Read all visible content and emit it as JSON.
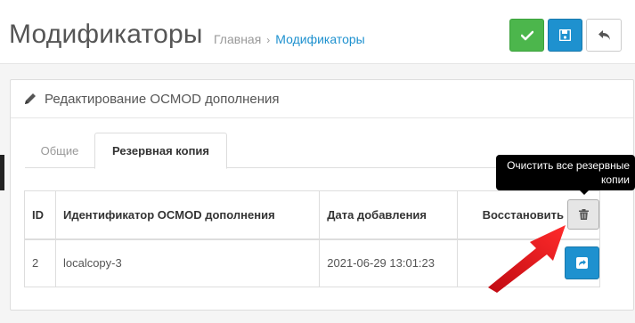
{
  "header": {
    "title": "Модификаторы",
    "breadcrumb": [
      {
        "label": "Главная"
      },
      {
        "label": "Модификаторы"
      }
    ],
    "breadcrumb_separator": "›"
  },
  "toolbar": {
    "save_icon": "check-icon",
    "save_alt_icon": "floppy-icon",
    "back_icon": "reply-icon",
    "colors": {
      "success": "#4cb64c",
      "primary": "#1e91cf"
    }
  },
  "panel": {
    "title": "Редактирование OCMOD дополнения",
    "icon": "pencil-icon"
  },
  "tabs": [
    {
      "label": "Общие",
      "active": false
    },
    {
      "label": "Резервная копия",
      "active": true
    }
  ],
  "table": {
    "headers": {
      "id": "ID",
      "name": "Идентификатор OCMOD дополнения",
      "date": "Дата добавления",
      "action": "Восстановить"
    },
    "rows": [
      {
        "id": "2",
        "name": "localcopy-3",
        "date": "2021-06-29 13:01:23"
      }
    ]
  },
  "tooltip": {
    "text": "Очистить все резервные копии"
  },
  "annotation": {
    "color": "#e8141d"
  }
}
